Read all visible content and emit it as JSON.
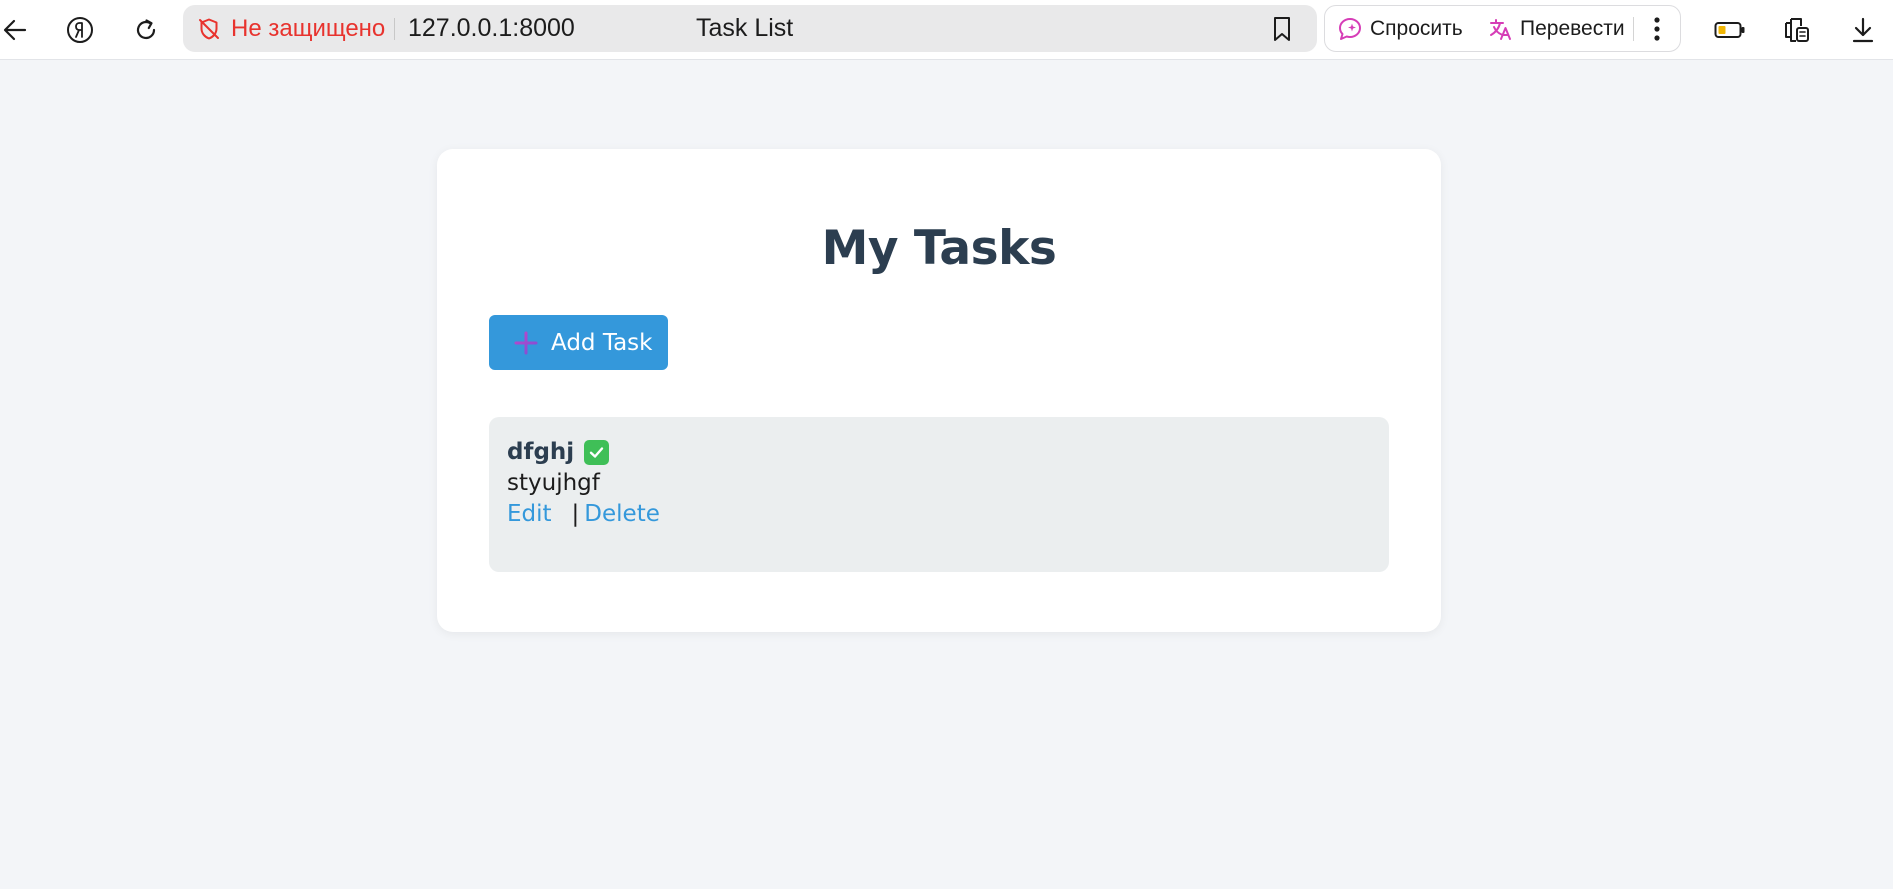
{
  "browser": {
    "security_label": "Не защищено",
    "url": "127.0.0.1:8000",
    "tab_title": "Task List",
    "ask_label": "Спросить",
    "translate_label": "Перевести",
    "icons": [
      "back-arrow-icon",
      "yandex-logo-icon",
      "reload-icon",
      "shield-off-icon",
      "bookmark-icon",
      "ask-ai-icon",
      "translate-icon",
      "more-vertical-icon",
      "battery-icon",
      "reader-mode-icon",
      "download-icon"
    ],
    "colors": {
      "insecure": "#e8332e",
      "ai_accent": "#d63db7"
    }
  },
  "page": {
    "title": "My Tasks",
    "add_button_label": "Add Task",
    "colors": {
      "accent": "#3498db",
      "title": "#2c3e50",
      "task_bg": "#ebeeef",
      "check": "#3fbf57"
    }
  },
  "tasks": [
    {
      "title": "dfghj",
      "completed": true,
      "description": "styujhgf",
      "edit_label": "Edit",
      "separator": "|",
      "delete_label": "Delete"
    }
  ]
}
